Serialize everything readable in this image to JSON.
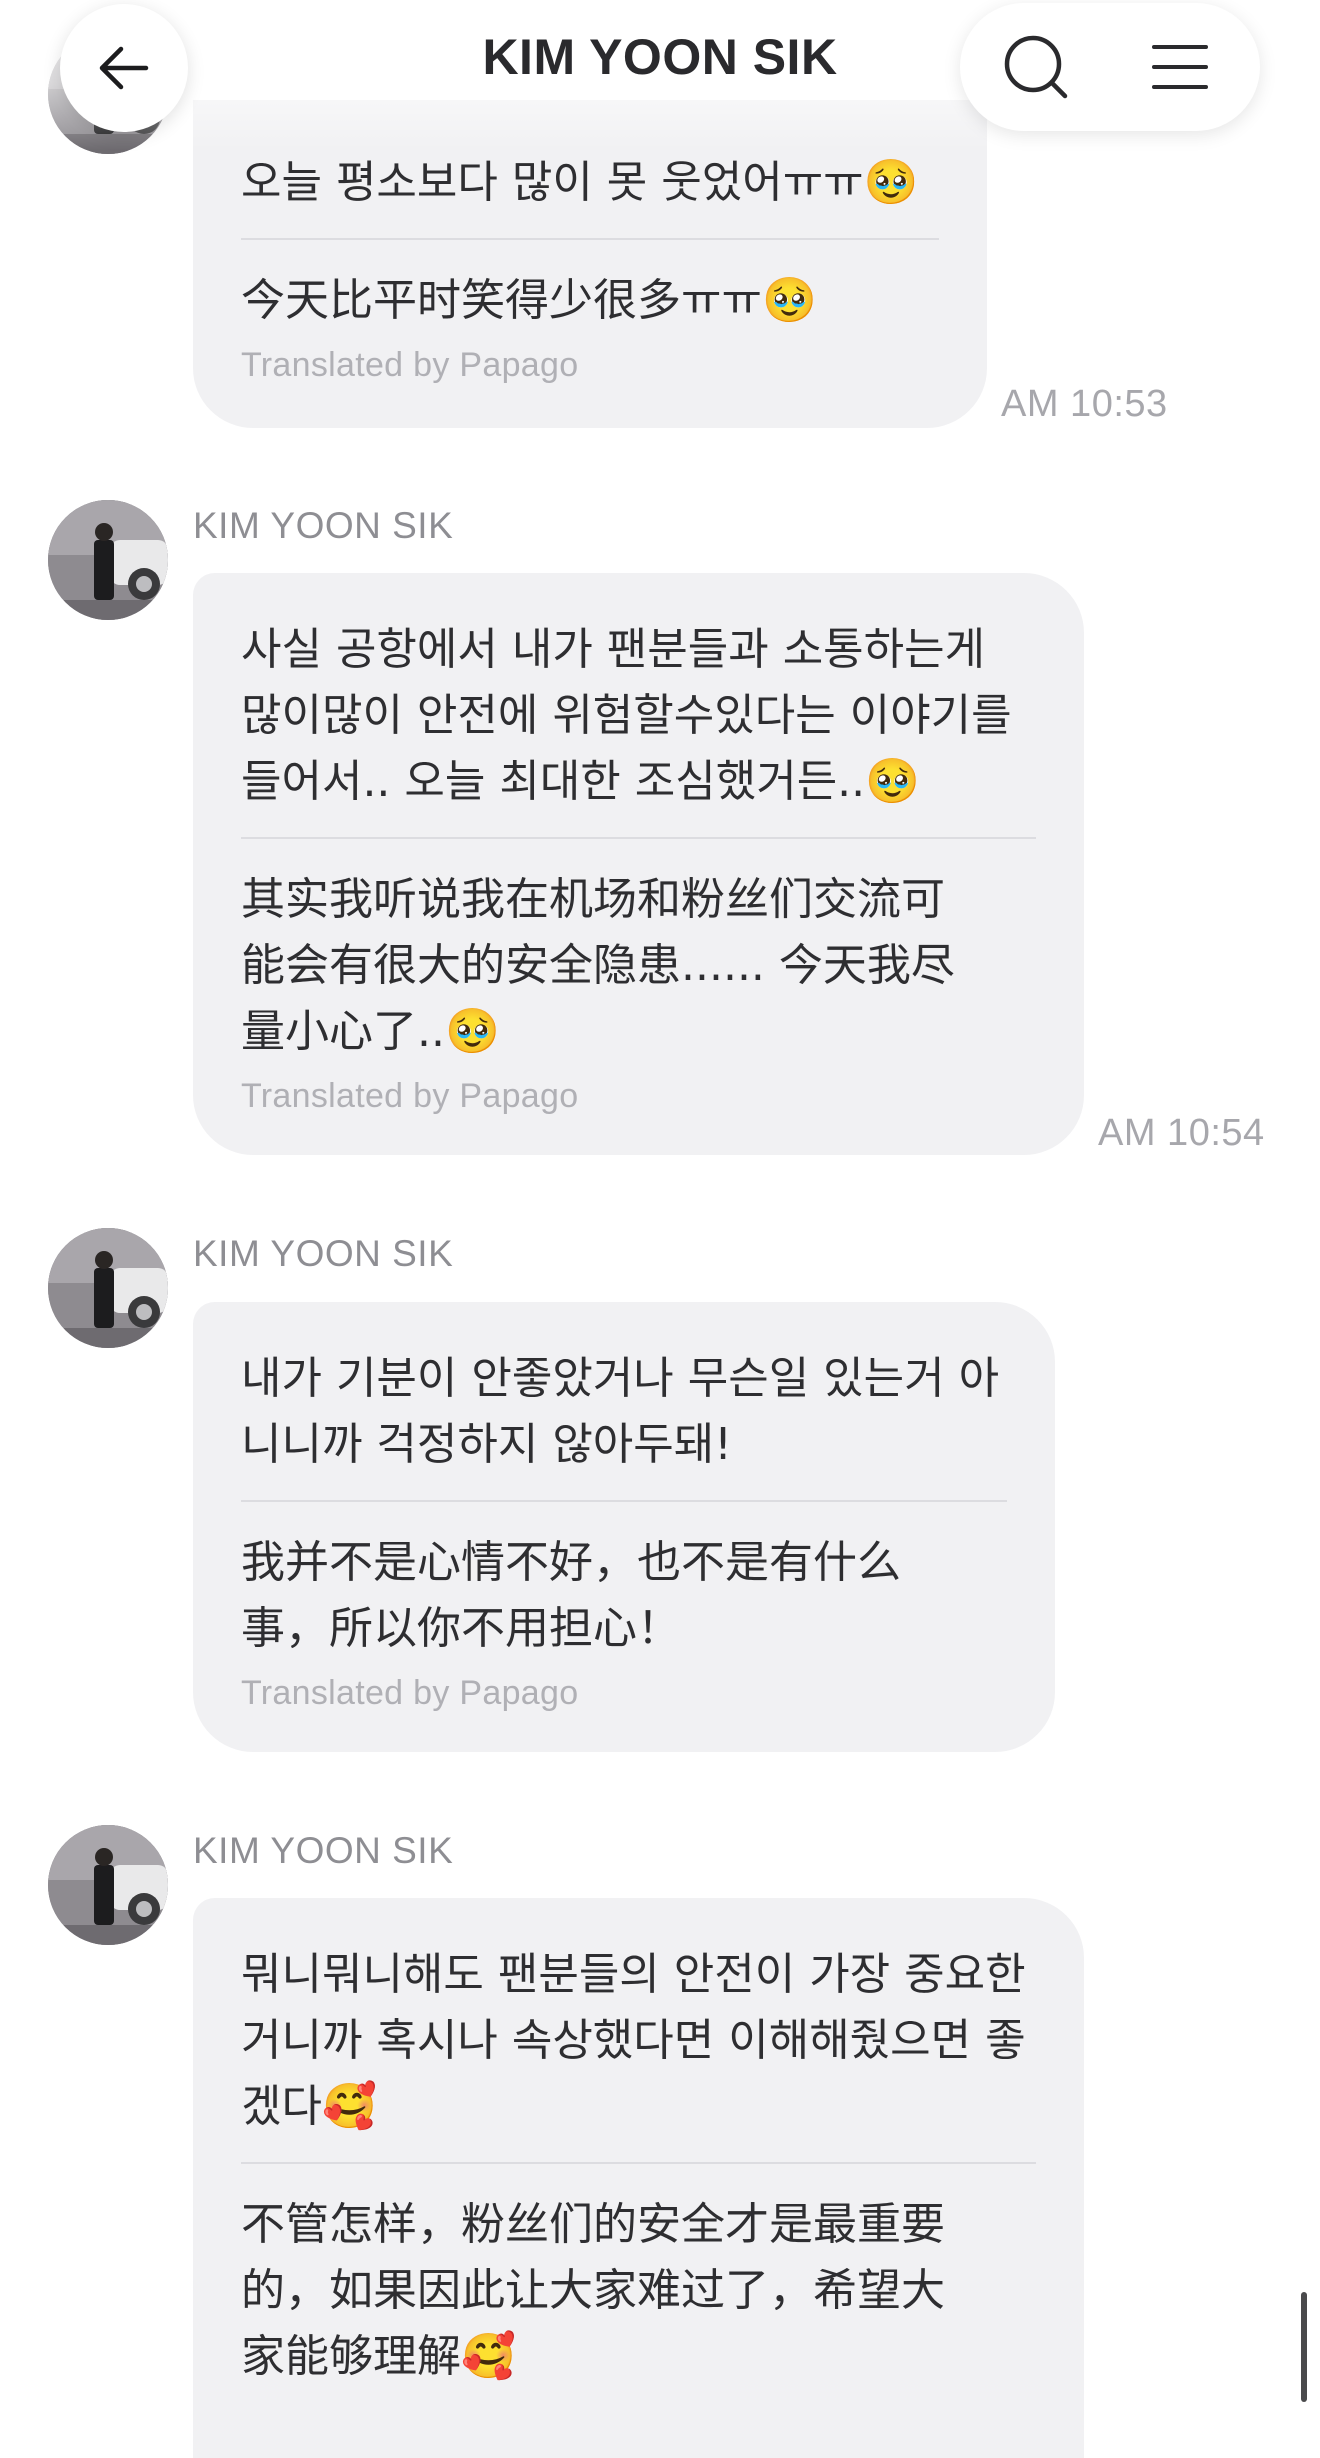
{
  "header": {
    "title": "KIM YOON SIK"
  },
  "icons": {
    "back": "arrow-left-icon",
    "search": "search-icon",
    "menu": "hamburger-menu-icon"
  },
  "translation_credit": "Translated by Papago",
  "messages": [
    {
      "sender": "KIM YOON SIK",
      "original": "오늘 평소보다 많이 못 웃었어ㅠㅠ🥹",
      "translated": "今天比平时笑得少很多ㅠㅠ🥹",
      "time": "AM 10:53"
    },
    {
      "sender": "KIM YOON SIK",
      "original": "사실 공항에서 내가 팬분들과 소통하는게\n많이많이 안전에 위험할수있다는 이야기를\n들어서.. 오늘 최대한 조심했거든..🥹",
      "translated": "其实我听说我在机场和粉丝们交流可\n能会有很大的安全隐患...... 今天我尽\n量小心了..🥹",
      "time": "AM 10:54"
    },
    {
      "sender": "KIM YOON SIK",
      "original": "내가 기분이 안좋았거나 무슨일 있는거 아\n니니까 걱정하지 않아두돼!",
      "translated": "我并不是心情不好，也不是有什么\n事，所以你不用担心！"
    },
    {
      "sender": "KIM YOON SIK",
      "original": "뭐니뭐니해도 팬분들의 안전이 가장 중요한\n거니까 혹시나 속상했다면 이해해줬으면 좋\n겠다🥰",
      "translated": "不管怎样，粉丝们的安全才是最重要\n的，如果因此让大家难过了，希望大\n家能够理解🥰"
    }
  ]
}
